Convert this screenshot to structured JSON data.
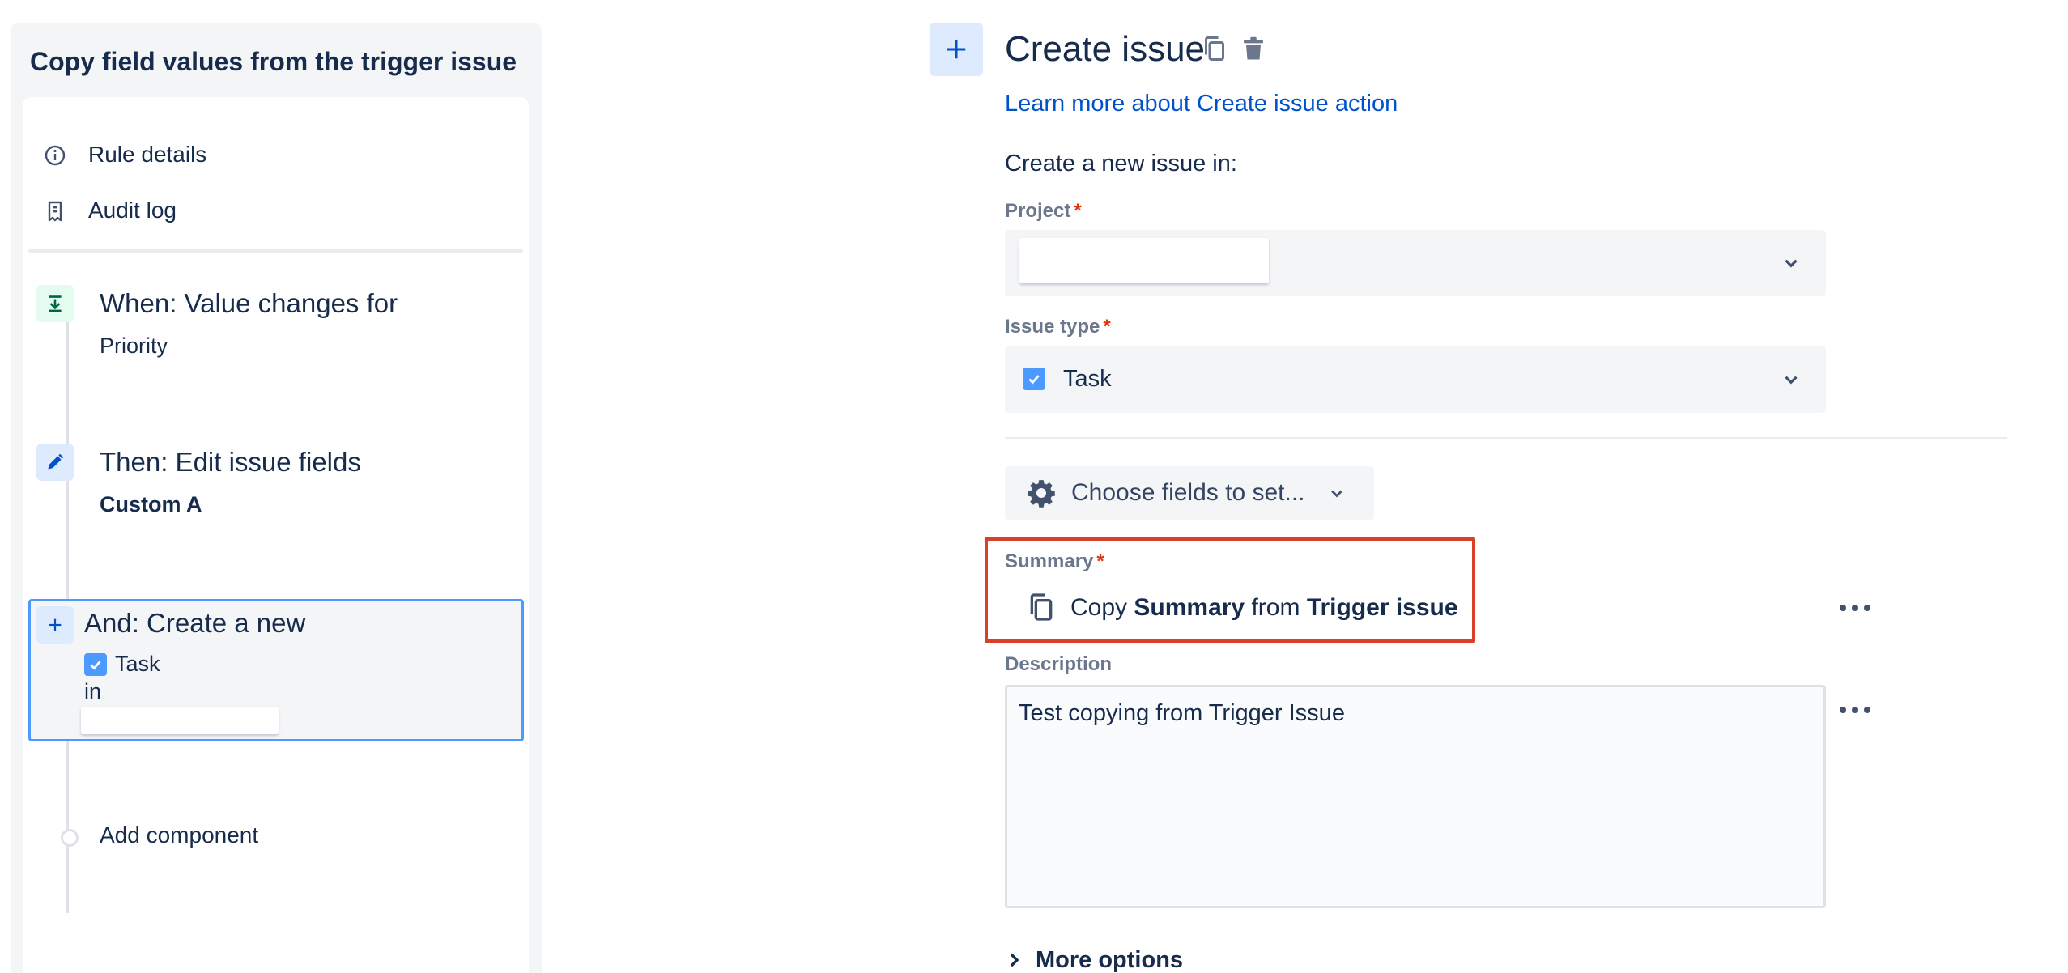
{
  "sidebar": {
    "title": "Copy field values from the trigger issue",
    "nav": [
      {
        "label": "Rule details",
        "icon": "info-icon"
      },
      {
        "label": "Audit log",
        "icon": "document-icon"
      }
    ],
    "components": [
      {
        "title": "When: Value changes for",
        "detail": "Priority",
        "icon": "field-change-icon"
      },
      {
        "title": "Then: Edit issue fields",
        "detail": "Custom A",
        "icon": "pencil-icon"
      },
      {
        "title": "And: Create a new",
        "detail_type": "Task",
        "detail_in": "in",
        "icon": "plus-icon",
        "selected": true
      }
    ],
    "add_component_label": "Add component"
  },
  "action": {
    "title": "Create issue",
    "learn_more": "Learn more about Create issue action",
    "create_in_label": "Create a new issue in:",
    "project": {
      "label": "Project",
      "required_mark": "*",
      "value": ""
    },
    "issue_type": {
      "label": "Issue type",
      "required_mark": "*",
      "value": "Task"
    },
    "choose_fields_label": "Choose fields to set...",
    "summary": {
      "label": "Summary",
      "required_mark": "*",
      "copy_prefix": "Copy",
      "copy_field": "Summary",
      "copy_mid": "from",
      "copy_source": "Trigger issue"
    },
    "description": {
      "label": "Description",
      "value": "Test copying from Trigger Issue"
    },
    "more_options_label": "More options"
  },
  "colors": {
    "accent": "#0052cc",
    "highlight": "#d9402b",
    "selected_border": "#4c9aff",
    "required": "#de350b"
  }
}
